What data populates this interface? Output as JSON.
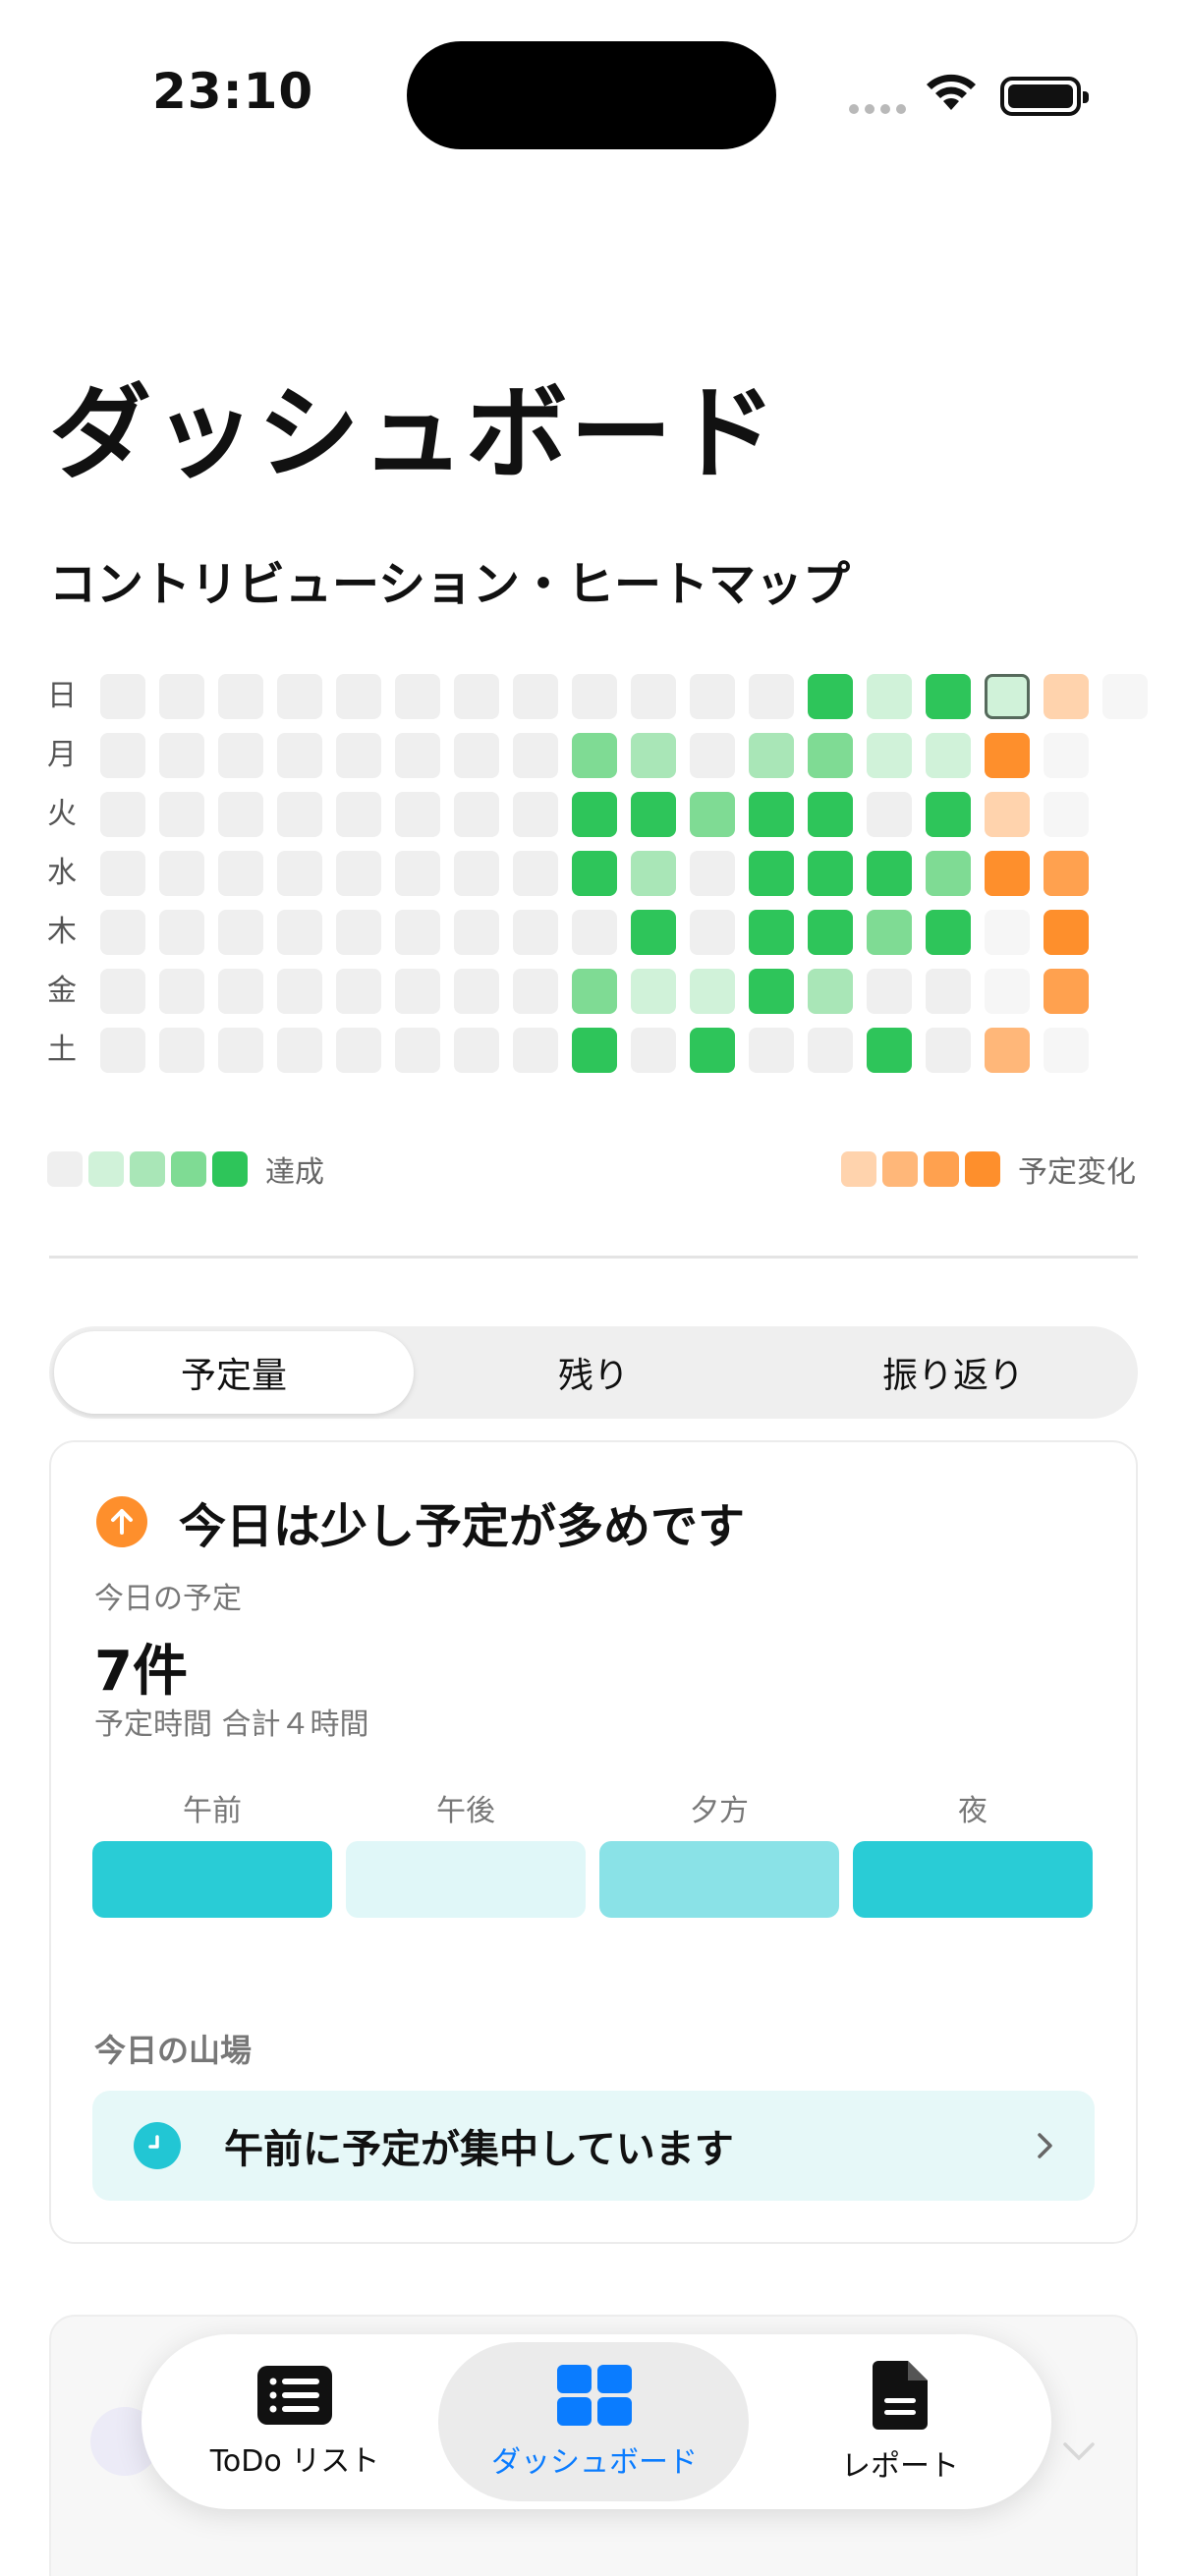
{
  "status_bar": {
    "time": "23:10"
  },
  "page_title": "ダッシュボード",
  "heatmap": {
    "title": "コントリビューション・ヒートマップ",
    "day_labels": [
      "日",
      "月",
      "火",
      "水",
      "木",
      "金",
      "土"
    ],
    "rows": [
      [
        "l0",
        "l0",
        "l0",
        "l0",
        "l0",
        "l0",
        "l0",
        "l0",
        "l0",
        "l0",
        "l0",
        "l0",
        "l4",
        "l1",
        "l4",
        "l1s",
        "o1",
        "empty"
      ],
      [
        "l0",
        "l0",
        "l0",
        "l0",
        "l0",
        "l0",
        "l0",
        "l0",
        "l3",
        "l2",
        "l0",
        "l2",
        "l3",
        "l1",
        "l1",
        "o4",
        "empty",
        ""
      ],
      [
        "l0",
        "l0",
        "l0",
        "l0",
        "l0",
        "l0",
        "l0",
        "l0",
        "l4",
        "l4",
        "l3",
        "l4",
        "l4",
        "l0",
        "l4",
        "o1",
        "empty",
        ""
      ],
      [
        "l0",
        "l0",
        "l0",
        "l0",
        "l0",
        "l0",
        "l0",
        "l0",
        "l4",
        "l2",
        "l0",
        "l4",
        "l4",
        "l4",
        "l3",
        "o4",
        "o3",
        ""
      ],
      [
        "l0",
        "l0",
        "l0",
        "l0",
        "l0",
        "l0",
        "l0",
        "l0",
        "l0",
        "l4",
        "l0",
        "l4",
        "l4",
        "l3",
        "l4",
        "empty",
        "o4",
        ""
      ],
      [
        "l0",
        "l0",
        "l0",
        "l0",
        "l0",
        "l0",
        "l0",
        "l0",
        "l3",
        "l1",
        "l1",
        "l4",
        "l2",
        "l0",
        "l0",
        "empty",
        "o3",
        ""
      ],
      [
        "l0",
        "l0",
        "l0",
        "l0",
        "l0",
        "l0",
        "l0",
        "l0",
        "l4",
        "l0",
        "l4",
        "l0",
        "l0",
        "l4",
        "l0",
        "o2",
        "empty",
        ""
      ]
    ],
    "legend_done_label": "達成",
    "legend_done_levels": [
      "l0",
      "l1",
      "l2",
      "l3",
      "l4"
    ],
    "legend_change_label": "予定変化",
    "legend_change_levels": [
      "o1",
      "o2",
      "o3",
      "o4"
    ]
  },
  "segmented": {
    "tabs": [
      "予定量",
      "残り",
      "振り返り"
    ],
    "selected": 0
  },
  "card": {
    "title": "今日は少し予定が多めです",
    "today_label": "今日の予定",
    "count": "7件",
    "total_time": "予定時間 合計４時間",
    "periods": [
      {
        "label": "午前",
        "color": "#29ccd6"
      },
      {
        "label": "午後",
        "color": "#e0f7f8"
      },
      {
        "label": "夕方",
        "color": "#8ae2e7"
      },
      {
        "label": "夜",
        "color": "#29ccd6"
      }
    ],
    "peak_label": "今日の山場",
    "peak_text": "午前に予定が集中しています"
  },
  "tabbar": {
    "items": [
      {
        "label": "ToDo リスト",
        "icon": "list-icon"
      },
      {
        "label": "ダッシュボード",
        "icon": "dashboard-grid-icon"
      },
      {
        "label": "レポート",
        "icon": "document-icon"
      }
    ],
    "active": 1
  },
  "colors": {
    "accent_blue": "#0a7cff",
    "green": "#2ec55a",
    "orange": "#fe8f2c",
    "teal": "#29ccd6"
  }
}
